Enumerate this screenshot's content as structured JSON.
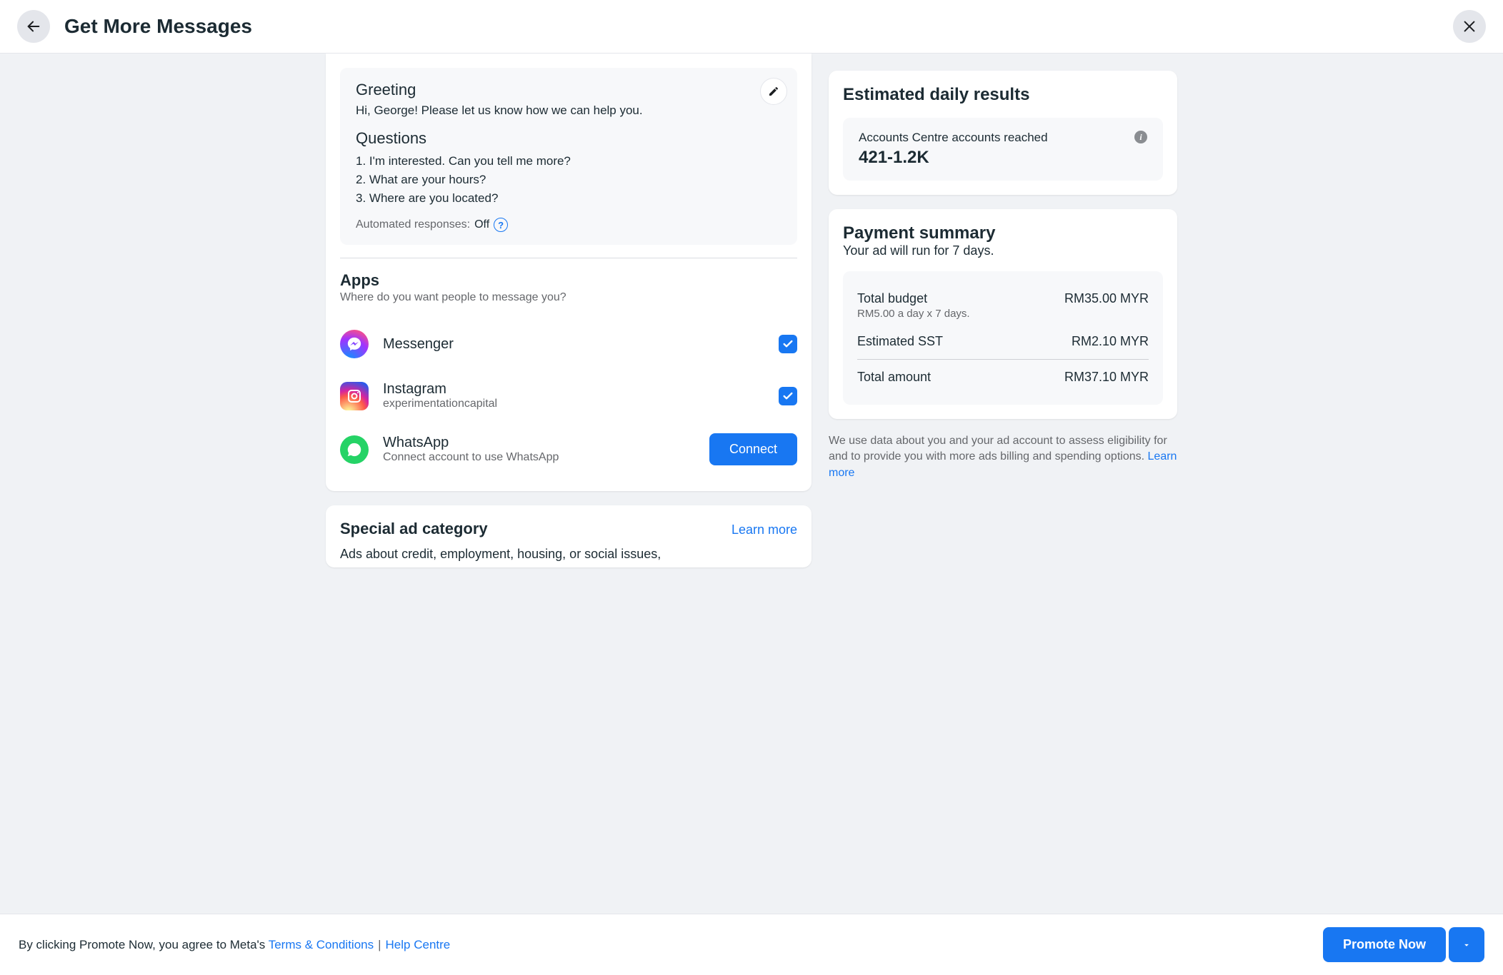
{
  "header": {
    "title": "Get More Messages"
  },
  "greeting": {
    "title": "Greeting",
    "text": "Hi, George! Please let us know how we can help you.",
    "questions_title": "Questions",
    "questions": [
      "I'm interested. Can you tell me more?",
      "What are your hours?",
      "Where are you located?"
    ],
    "auto_label": "Automated responses:",
    "auto_value": "Off"
  },
  "apps": {
    "title": "Apps",
    "subtitle": "Where do you want people to message you?",
    "items": {
      "messenger": {
        "name": "Messenger",
        "checked": true
      },
      "instagram": {
        "name": "Instagram",
        "sub": "experimentationcapital",
        "checked": true
      },
      "whatsapp": {
        "name": "WhatsApp",
        "sub": "Connect account to use WhatsApp",
        "connect_label": "Connect"
      }
    }
  },
  "special": {
    "title": "Special ad category",
    "learn_more": "Learn more",
    "desc": "Ads about credit, employment, housing, or social issues,"
  },
  "results": {
    "title": "Estimated daily results",
    "metric_label": "Accounts Centre accounts reached",
    "metric_value": "421-1.2K"
  },
  "payment": {
    "title": "Payment summary",
    "subtitle": "Your ad will run for 7 days.",
    "budget_label": "Total budget",
    "budget_sub": "RM5.00 a day x 7 days.",
    "budget_amount": "RM35.00 MYR",
    "sst_label": "Estimated SST",
    "sst_amount": "RM2.10 MYR",
    "total_label": "Total amount",
    "total_amount": "RM37.10 MYR"
  },
  "disclaimer": {
    "text_a": "We use data about you and your ad account to assess eligibility for and to provide you with more ads billing and spending options. ",
    "link": "Learn more"
  },
  "footer": {
    "prefix": "By clicking Promote Now, you agree to Meta's ",
    "terms": "Terms & Conditions",
    "help": "Help Centre",
    "promote": "Promote Now"
  }
}
